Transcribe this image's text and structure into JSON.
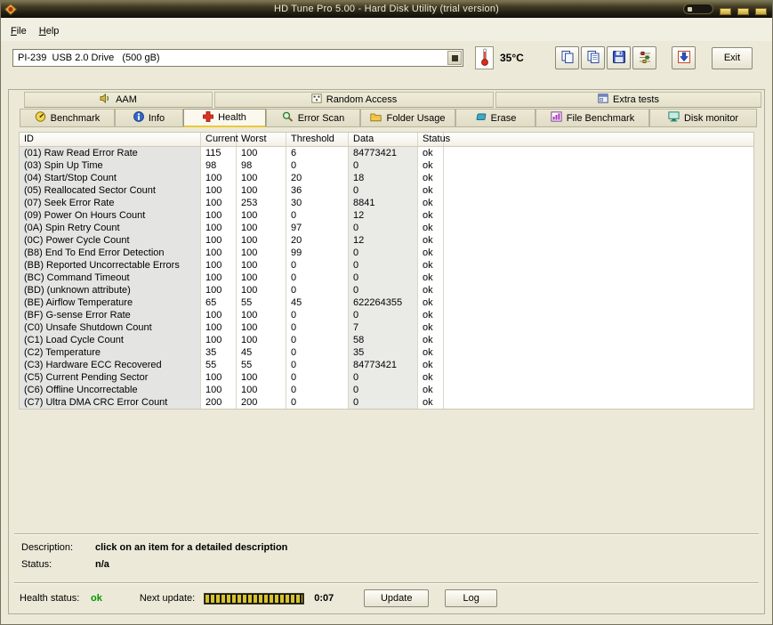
{
  "window": {
    "title": "HD Tune Pro 5.00 - Hard Disk Utility (trial version)"
  },
  "menu": {
    "items": [
      "File",
      "Help"
    ]
  },
  "toolbar": {
    "drive_selector_value": "PI-239  USB 2.0 Drive   (500 gB)",
    "temperature": "35°C",
    "exit_label": "Exit",
    "icons": [
      "thermometer-icon",
      "dropdown-icon",
      "copy-image-icon",
      "copy-text-icon",
      "save-icon",
      "options-icon",
      "capture-icon"
    ]
  },
  "titlebar_icons": [
    "app-icon",
    "rollup-button",
    "minimize-button",
    "maximize-button",
    "close-button"
  ],
  "tabs": {
    "row1": [
      {
        "label": "AAM",
        "icon": "speaker-icon"
      },
      {
        "label": "Random Access",
        "icon": "random-access-icon"
      },
      {
        "label": "Extra tests",
        "icon": "extra-tests-icon"
      }
    ],
    "row2": [
      {
        "label": "Benchmark",
        "icon": "benchmark-icon",
        "active": false
      },
      {
        "label": "Info",
        "icon": "info-icon",
        "active": false
      },
      {
        "label": "Health",
        "icon": "health-cross-icon",
        "active": true
      },
      {
        "label": "Error Scan",
        "icon": "magnifier-icon",
        "active": false
      },
      {
        "label": "Folder Usage",
        "icon": "folder-icon",
        "active": false
      },
      {
        "label": "Erase",
        "icon": "eraser-icon",
        "active": false
      },
      {
        "label": "File Benchmark",
        "icon": "file-benchmark-icon",
        "active": false
      },
      {
        "label": "Disk monitor",
        "icon": "disk-monitor-icon",
        "active": false
      }
    ]
  },
  "health_table": {
    "columns": [
      "ID",
      "Current",
      "Worst",
      "Threshold",
      "Data",
      "Status"
    ],
    "rows": [
      [
        "(01) Raw Read Error Rate",
        "115",
        "100",
        "6",
        "84773421",
        "ok"
      ],
      [
        "(03) Spin Up Time",
        "98",
        "98",
        "0",
        "0",
        "ok"
      ],
      [
        "(04) Start/Stop Count",
        "100",
        "100",
        "20",
        "18",
        "ok"
      ],
      [
        "(05) Reallocated Sector Count",
        "100",
        "100",
        "36",
        "0",
        "ok"
      ],
      [
        "(07) Seek Error Rate",
        "100",
        "253",
        "30",
        "8841",
        "ok"
      ],
      [
        "(09) Power On Hours Count",
        "100",
        "100",
        "0",
        "12",
        "ok"
      ],
      [
        "(0A) Spin Retry Count",
        "100",
        "100",
        "97",
        "0",
        "ok"
      ],
      [
        "(0C) Power Cycle Count",
        "100",
        "100",
        "20",
        "12",
        "ok"
      ],
      [
        "(B8) End To End Error Detection",
        "100",
        "100",
        "99",
        "0",
        "ok"
      ],
      [
        "(BB) Reported Uncorrectable Errors",
        "100",
        "100",
        "0",
        "0",
        "ok"
      ],
      [
        "(BC) Command Timeout",
        "100",
        "100",
        "0",
        "0",
        "ok"
      ],
      [
        "(BD) (unknown attribute)",
        "100",
        "100",
        "0",
        "0",
        "ok"
      ],
      [
        "(BE) Airflow Temperature",
        "65",
        "55",
        "45",
        "622264355",
        "ok"
      ],
      [
        "(BF) G-sense Error Rate",
        "100",
        "100",
        "0",
        "0",
        "ok"
      ],
      [
        "(C0) Unsafe Shutdown Count",
        "100",
        "100",
        "0",
        "7",
        "ok"
      ],
      [
        "(C1) Load Cycle Count",
        "100",
        "100",
        "0",
        "58",
        "ok"
      ],
      [
        "(C2) Temperature",
        "35",
        "45",
        "0",
        "35",
        "ok"
      ],
      [
        "(C3) Hardware ECC Recovered",
        "55",
        "55",
        "0",
        "84773421",
        "ok"
      ],
      [
        "(C5) Current Pending Sector",
        "100",
        "100",
        "0",
        "0",
        "ok"
      ],
      [
        "(C6) Offline Uncorrectable",
        "100",
        "100",
        "0",
        "0",
        "ok"
      ],
      [
        "(C7) Ultra DMA CRC Error Count",
        "200",
        "200",
        "0",
        "0",
        "ok"
      ]
    ]
  },
  "details": {
    "description_label": "Description:",
    "description_value": "click on an item for a detailed description",
    "status_label": "Status:",
    "status_value": "n/a"
  },
  "footer": {
    "health_status_label": "Health status:",
    "health_status_value": "ok",
    "next_update_label": "Next update:",
    "countdown": "0:07",
    "update_button": "Update",
    "log_button": "Log"
  },
  "colors": {
    "health_ok_green": "#009600",
    "titlebar_gold": "#d9b94a",
    "progress_yellow": "#d6c22e",
    "health_cross_red": "#e03224"
  }
}
